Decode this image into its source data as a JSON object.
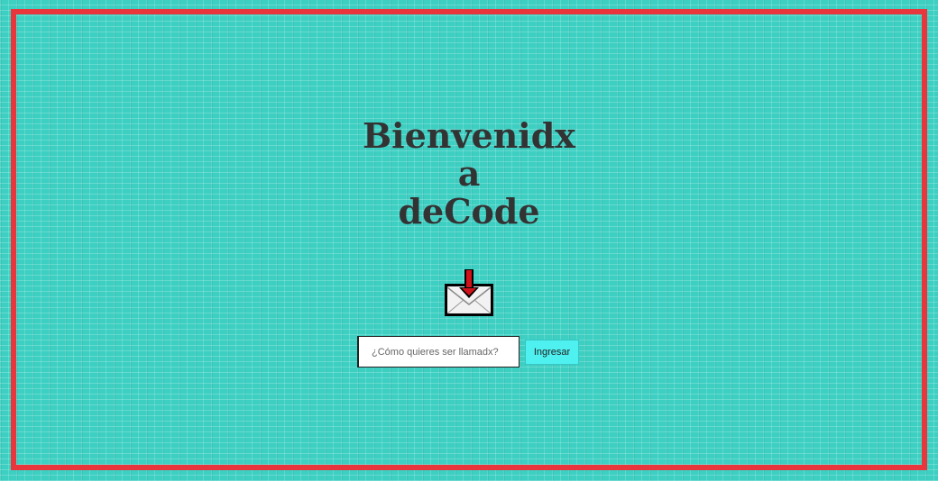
{
  "heading": {
    "line1": "Bienvenidx",
    "line2": "a",
    "line3": "deCode"
  },
  "icons": {
    "mail": "mail-download-icon"
  },
  "form": {
    "name_placeholder": "¿Cómo quieres ser llamadx?",
    "name_value": "",
    "submit_label": "Ingresar"
  },
  "colors": {
    "background": "#3ccfc2",
    "frame": "#e8363c",
    "button": "#4ff0f0",
    "title": "#333333"
  }
}
